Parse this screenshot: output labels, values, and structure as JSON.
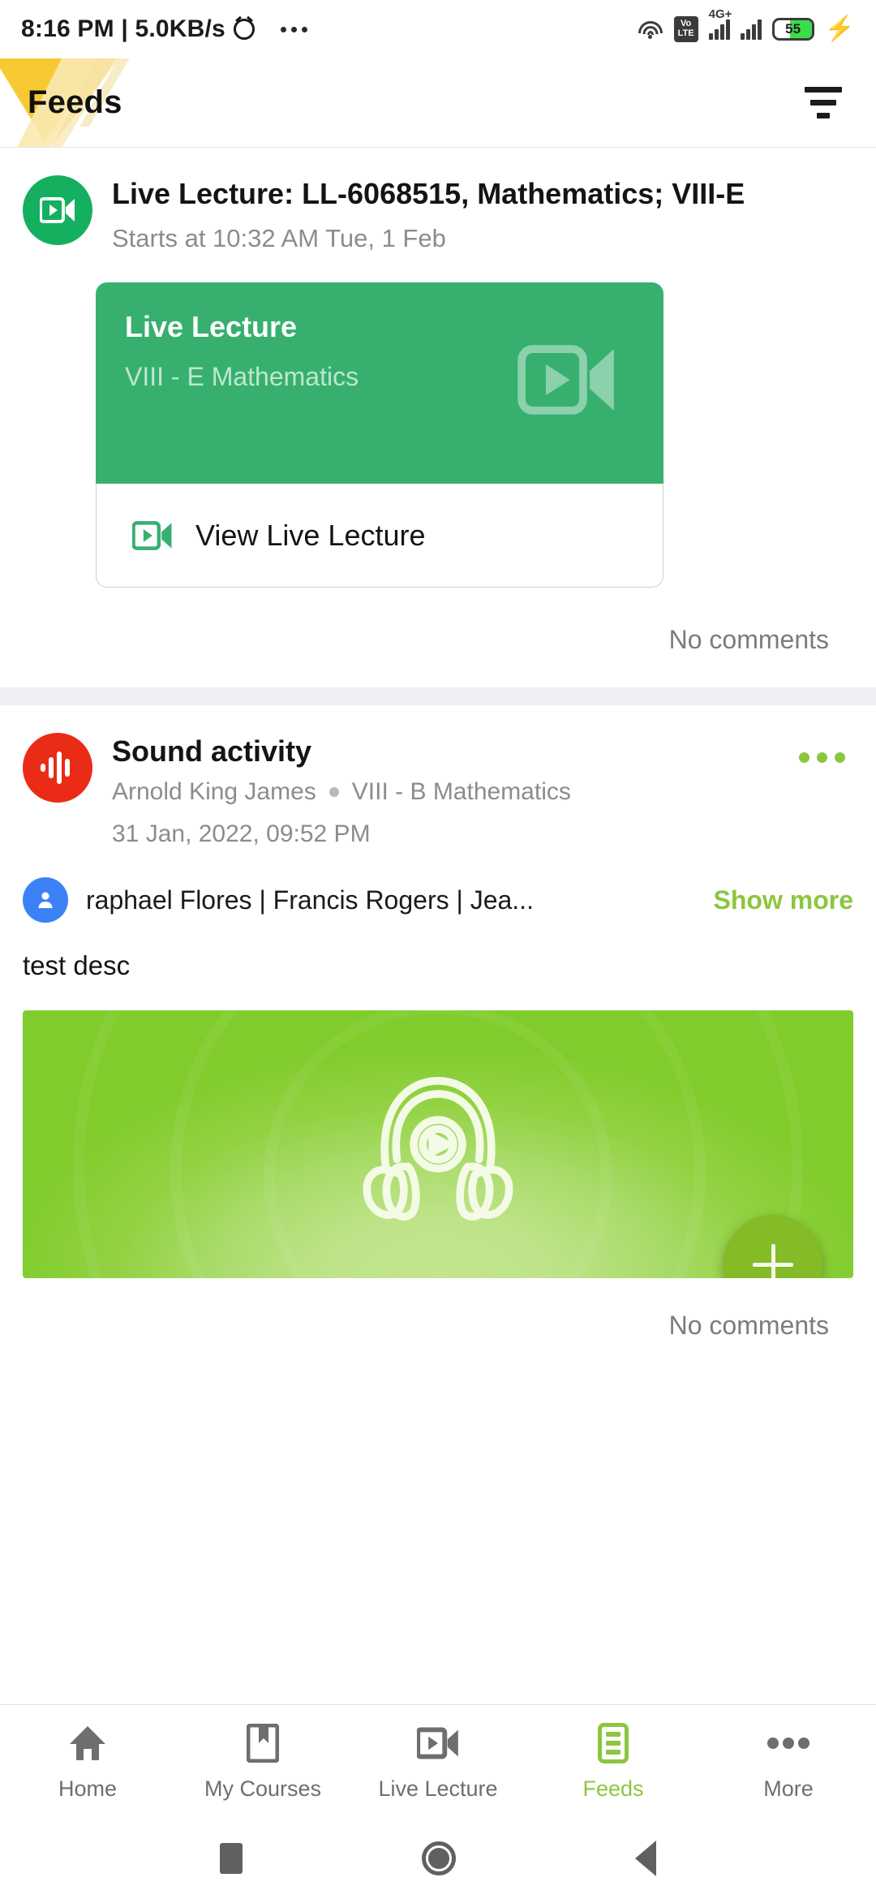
{
  "status_bar": {
    "time": "8:16 PM",
    "separator": "|",
    "network_speed": "5.0KB/s",
    "alarm_icon": "alarm-icon",
    "overflow_icon": "more-dots-icon",
    "wifi_icon": "wifi-icon",
    "volte_top": "Vo",
    "volte_bottom": "LTE",
    "network_type": "4G+",
    "battery_level": "55",
    "charging_icon": "lightning-bolt-icon"
  },
  "header": {
    "title": "Feeds",
    "filter_icon": "filter-icon",
    "logo_accent_color": "#f8c933"
  },
  "feed": {
    "posts": [
      {
        "avatar_icon": "video-camera-icon",
        "avatar_color": "#14af5f",
        "title": "Live Lecture: LL-6068515, Mathematics; VIII-E",
        "subtitle": "Starts at 10:32 AM Tue, 1 Feb",
        "card": {
          "heading": "Live Lecture",
          "subheading": "VIII - E Mathematics",
          "background_color": "#37b06f",
          "watermark_icon": "video-camera-icon",
          "action_label": "View Live Lecture",
          "action_icon": "video-camera-icon"
        },
        "comments_label": "No comments"
      },
      {
        "avatar_icon": "sound-wave-icon",
        "avatar_color": "#ea2c16",
        "title": "Sound activity",
        "author": "Arnold King James",
        "course": "VIII - B Mathematics",
        "timestamp": "31 Jan, 2022, 09:52 PM",
        "menu_icon": "kebab-menu-icon",
        "recipients_icon": "person-icon",
        "recipients": "raphael Flores  |  Francis Rogers  |  Jea...",
        "show_more_label": "Show more",
        "show_more_color": "#8cc63f",
        "description": "test desc",
        "media_icon": "headphones-play-icon",
        "media_background_color": "#8cd13d",
        "comments_label": "No comments"
      }
    ]
  },
  "fab": {
    "icon": "plus-icon",
    "color": "#84bb26"
  },
  "bottom_nav": {
    "items": [
      {
        "label": "Home",
        "icon": "home-icon",
        "active": false
      },
      {
        "label": "My Courses",
        "icon": "book-bookmark-icon",
        "active": false
      },
      {
        "label": "Live Lecture",
        "icon": "video-camera-icon",
        "active": false
      },
      {
        "label": "Feeds",
        "icon": "feed-list-icon",
        "active": true
      },
      {
        "label": "More",
        "icon": "more-dots-icon",
        "active": false
      }
    ],
    "active_color": "#8cc63f",
    "inactive_color": "#6e6e6e"
  },
  "android_nav": {
    "recents_icon": "square-recents-icon",
    "home_icon": "circle-home-icon",
    "back_icon": "triangle-back-icon"
  }
}
